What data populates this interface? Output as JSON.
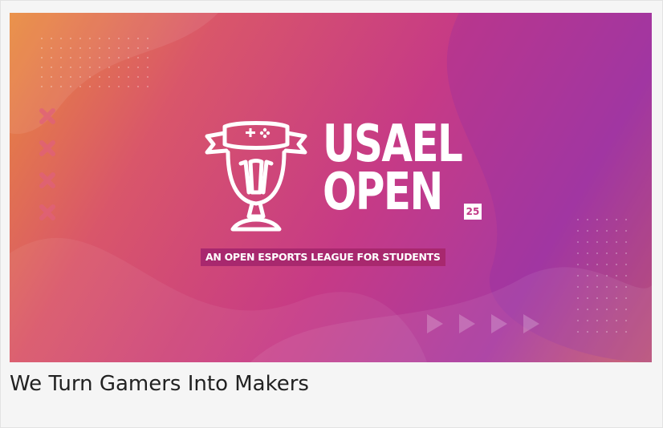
{
  "card": {
    "title": "We Turn Gamers Into Makers"
  },
  "banner": {
    "wordmark_line1": "USAEL",
    "wordmark_line2": "OPEN",
    "year_badge": "25",
    "tagline": "AN OPEN ESPORTS LEAGUE FOR STUDENTS",
    "logo_icon": "trophy-controller-icon"
  },
  "colors": {
    "gradient_start": "#e98a3c",
    "gradient_mid": "#c63a86",
    "gradient_end": "#a83aa0",
    "tagline_bg": "#a8286e",
    "text": "#ffffff",
    "caption_text": "#222222"
  }
}
